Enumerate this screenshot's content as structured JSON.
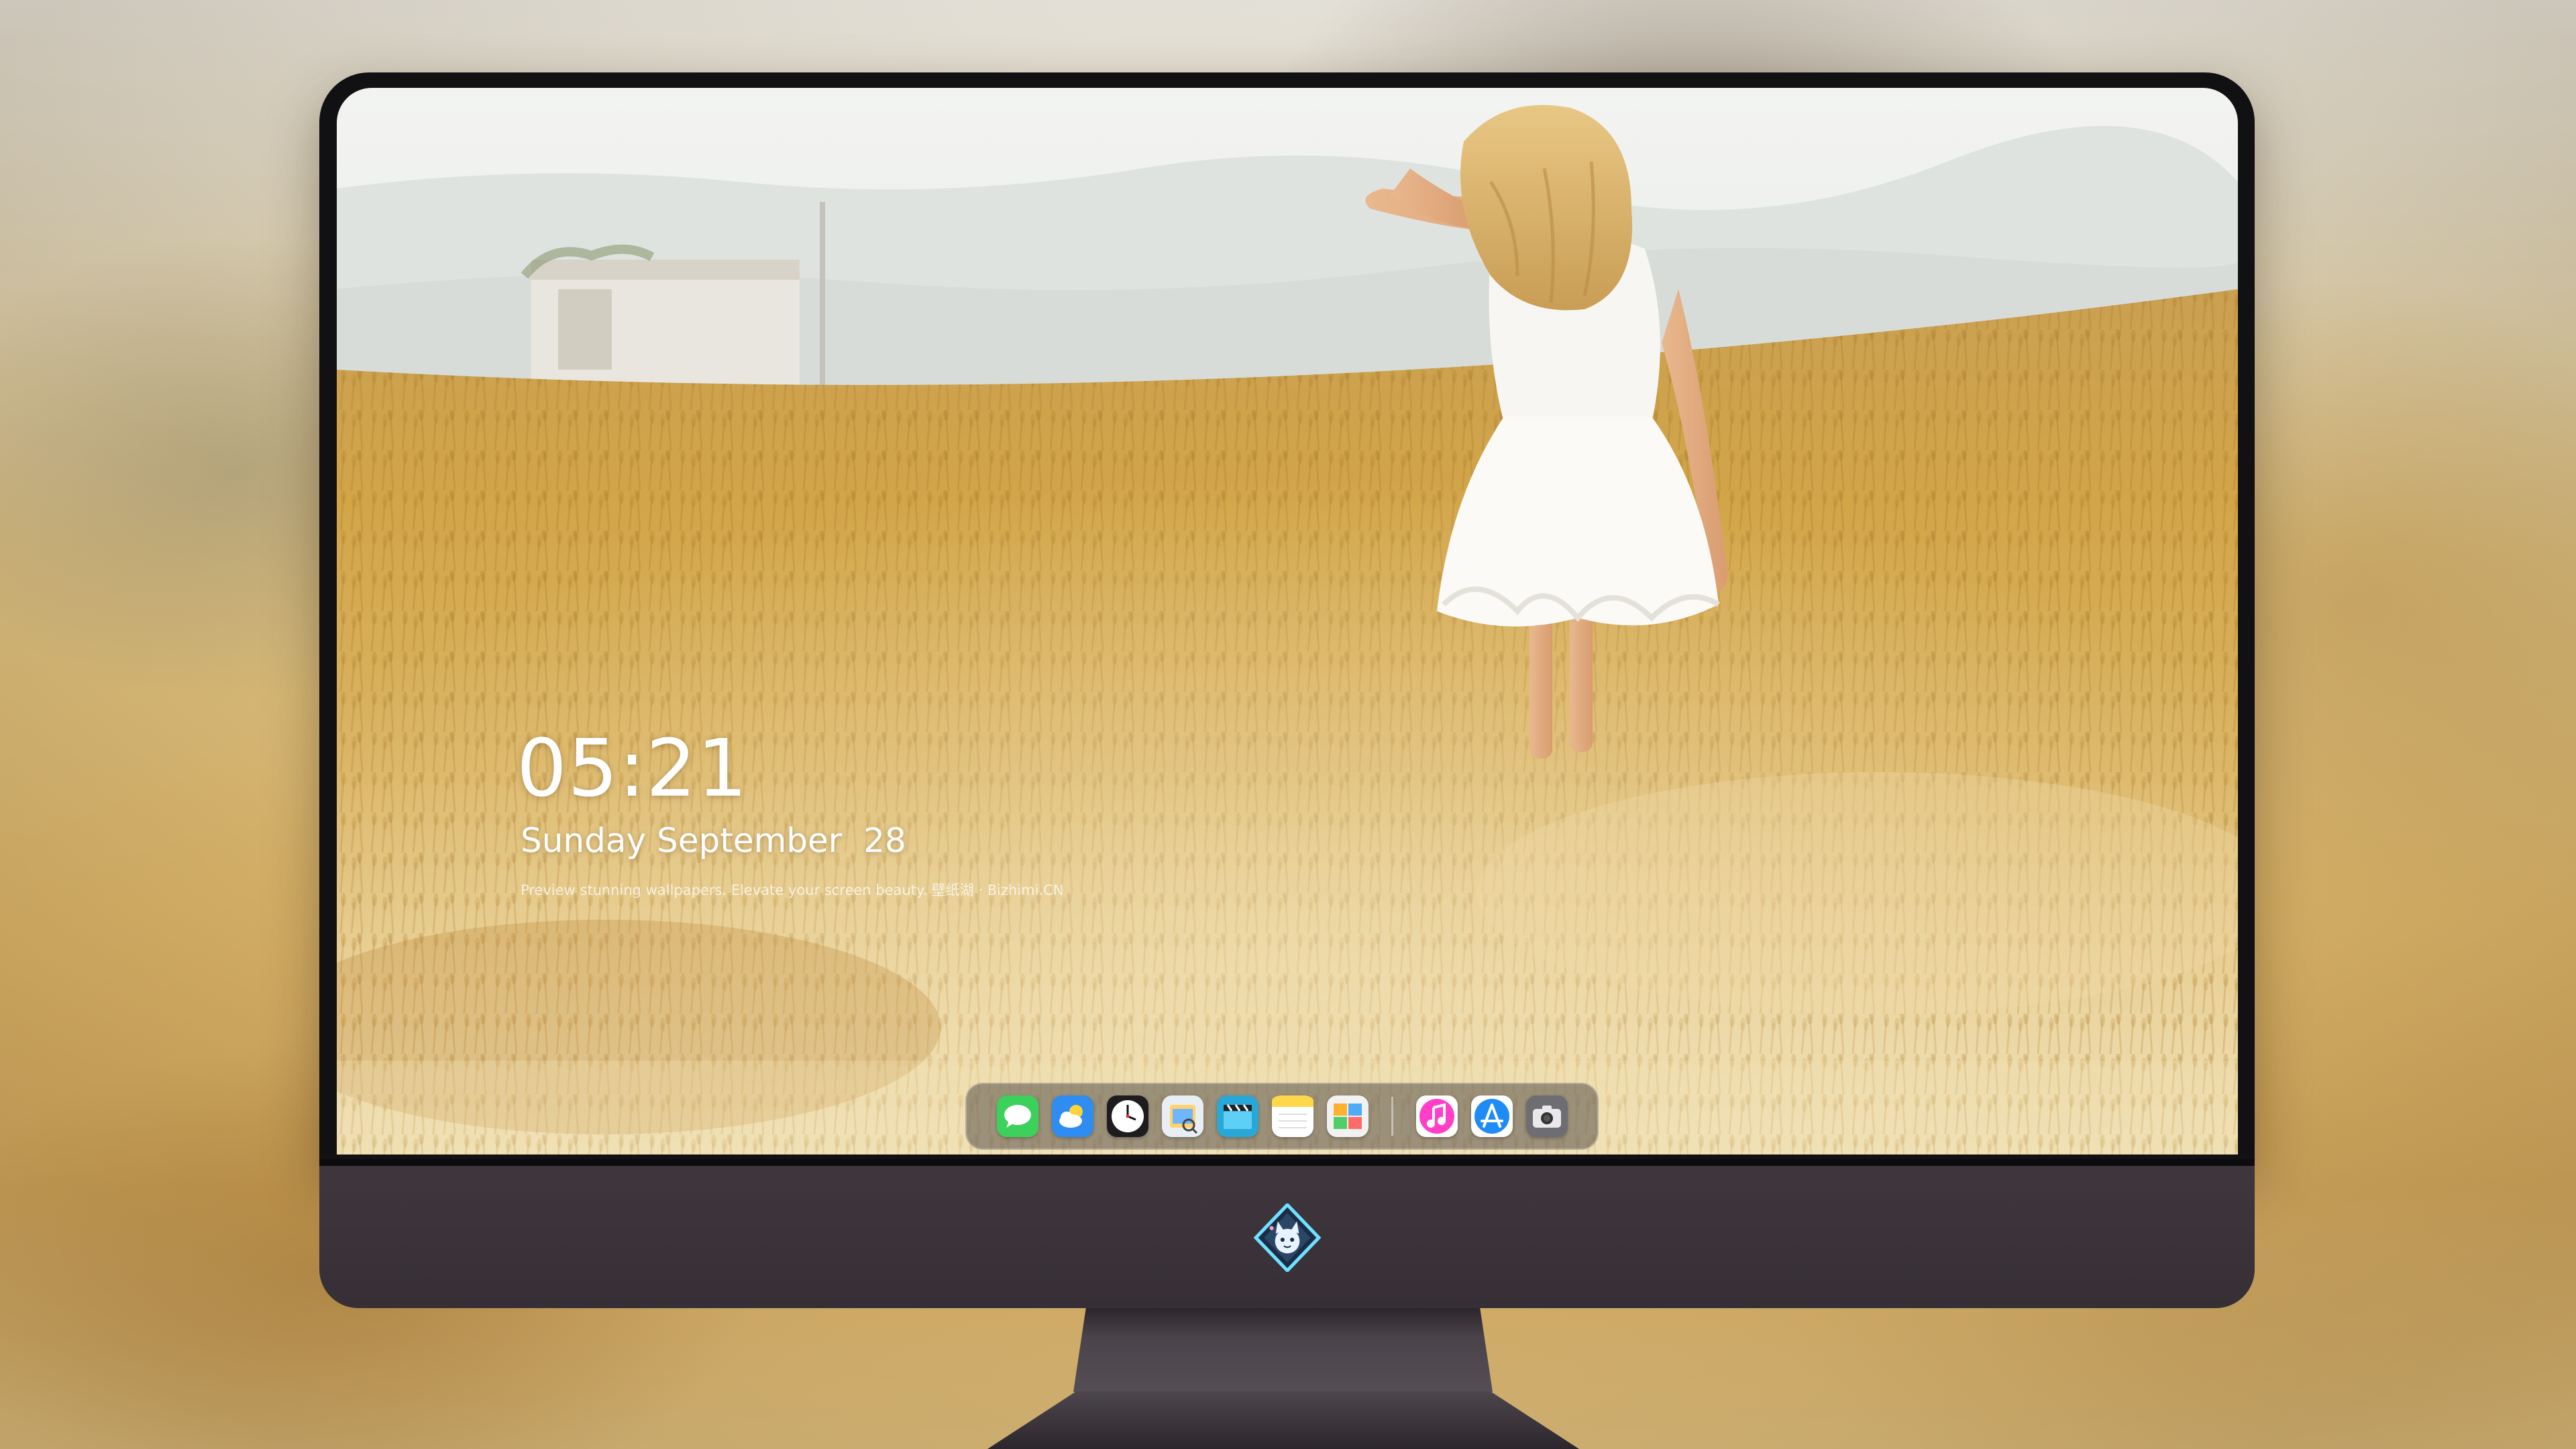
{
  "lock_screen": {
    "time": "05:21",
    "date": "Sunday September  28",
    "tagline": "Preview stunning wallpapers. Elevate your screen beauty. 壁纸湖 · Bizhimi.CN"
  },
  "dock": {
    "apps": [
      {
        "name": "messages-icon",
        "color": "#3bd15a"
      },
      {
        "name": "weather-icon",
        "color": "#2f8cf0"
      },
      {
        "name": "clock-icon",
        "color": "#1d1d1f"
      },
      {
        "name": "preview-icon",
        "color": "#e9eef5"
      },
      {
        "name": "video-clapper-icon",
        "color": "#27a8d8"
      },
      {
        "name": "notes-icon",
        "color": "#ffd84a"
      },
      {
        "name": "photo-gallery-icon",
        "color": "#f2f2f2"
      },
      {
        "divider": true
      },
      {
        "name": "music-icon",
        "color": "#ff3fc8"
      },
      {
        "name": "app-store-icon",
        "color": "#1f8bf5"
      },
      {
        "name": "camera-icon",
        "color": "#6d6d72"
      }
    ]
  },
  "monitor": {
    "logo_icon": "fox-mascot-logo"
  }
}
